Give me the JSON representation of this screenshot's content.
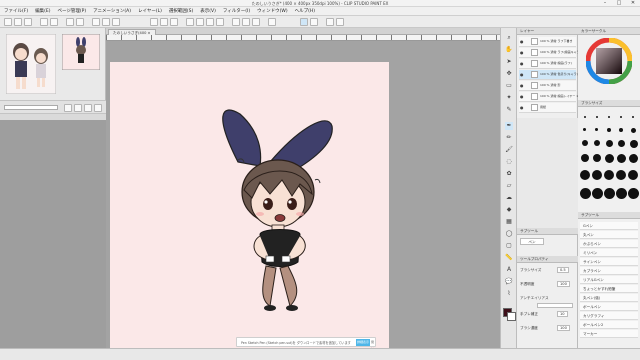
{
  "window": {
    "title": "たのしいうさぎ* (400 × 400px 350dpi 100%) - CLIP STUDIO PAINT EX",
    "minimize": "–",
    "maximize": "□",
    "close": "✕"
  },
  "menu": [
    "ファイル(F)",
    "編集(E)",
    "ページ管理(P)",
    "アニメーション(A)",
    "レイヤー(L)",
    "選択範囲(S)",
    "表示(V)",
    "フィルター(I)",
    "ウィンドウ(W)",
    "ヘルプ(H)"
  ],
  "canvas": {
    "tab_label": "たのしいうさぎ(400 ×",
    "background": "#fbe8e8"
  },
  "toast": {
    "message": "Pen Sketch Pen (Sketch pen.sut)を ダウンロードで素材を追加しています",
    "primary_button": "詳細表示",
    "secondary_button": "閉じる"
  },
  "layers": {
    "header": "レイヤー",
    "rows": [
      {
        "name": "100 % 通常 ラフ下書き"
      },
      {
        "name": "100 % 通常 ラフ(線画キャラ)"
      },
      {
        "name": "100 % 通常 線画(ラフ)"
      },
      {
        "name": "100 % 通常 色塗り(キャラ)",
        "selected": true
      },
      {
        "name": "100 % 通常 影"
      },
      {
        "name": "100 % 通常 線画レイヤー 1"
      },
      {
        "name": "用紙"
      }
    ]
  },
  "tool_property": {
    "header": "ツールプロパティ",
    "rows": [
      {
        "label": "ブラシサイズ",
        "value": "0.5"
      },
      {
        "label": "不透明度",
        "value": "100"
      },
      {
        "label": "アンチエイリアス",
        "value": ""
      },
      {
        "label": "手ブレ補正",
        "value": "10"
      },
      {
        "label": "ブラシ濃度",
        "value": "100"
      }
    ]
  },
  "sub_tool": {
    "header": "サブツール",
    "tab": "ペン"
  },
  "color": {
    "header": "カラーサークル",
    "main_color": "#3d0f19",
    "ring_colors": [
      "#e53935",
      "#fbc02d",
      "#43a047",
      "#1e88e5",
      "#8e24aa"
    ]
  },
  "brush_list": {
    "header": "ブラシサイズ",
    "items": [
      "Gペン",
      "丸ペン",
      "かぶらペン",
      "ミリペン",
      "サインペン",
      "カブラペン",
      "リアルGペン",
      "ちょっとかすれ鉛筆",
      "丸ペン(強)",
      "ボールペン",
      "カリグラフィ",
      "ボールペン2",
      "マーカー"
    ]
  }
}
